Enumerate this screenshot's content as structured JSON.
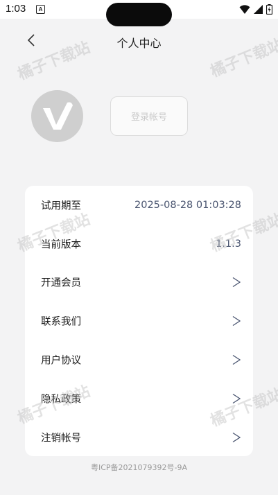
{
  "status_bar": {
    "time": "1:03",
    "notification_letter": "A"
  },
  "header": {
    "title": "个人中心"
  },
  "login": {
    "label": "登录帐号"
  },
  "settings": [
    {
      "label": "试用期至",
      "value": "2025-08-28 01:03:28",
      "type": "value"
    },
    {
      "label": "当前版本",
      "value": "1.1.3",
      "type": "value"
    },
    {
      "label": "开通会员",
      "type": "chevron"
    },
    {
      "label": "联系我们",
      "type": "chevron"
    },
    {
      "label": "用户协议",
      "type": "chevron"
    },
    {
      "label": "隐私政策",
      "type": "chevron"
    },
    {
      "label": "注销帐号",
      "type": "chevron"
    }
  ],
  "footer": {
    "icp": "粤ICP备2021079392号-9A"
  },
  "watermark": {
    "text": "橘子下载站"
  },
  "colors": {
    "background": "#f3f3f4",
    "card": "#ffffff",
    "avatar": "#cfcfcf",
    "value_text": "#4a5570"
  }
}
